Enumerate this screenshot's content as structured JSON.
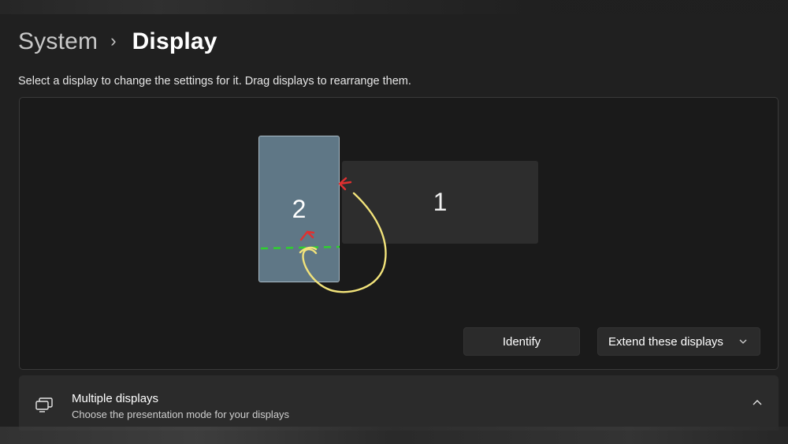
{
  "header": {
    "parent": "System",
    "separator": "›",
    "current": "Display"
  },
  "subtitle": "Select a display to change the settings for it. Drag displays to rearrange them.",
  "arrangement": {
    "displays": [
      {
        "number": "2",
        "selected": true
      },
      {
        "number": "1",
        "selected": false
      }
    ],
    "annotation_colors": {
      "arrow_red": "#e03030",
      "curve_yellow": "#f2e37a",
      "guide_green": "#2fd02f"
    }
  },
  "buttons": {
    "identify": "Identify",
    "extend": "Extend these displays",
    "extend_icon": "chevron-down-icon"
  },
  "multiple_displays": {
    "title": "Multiple displays",
    "description": "Choose the presentation mode for your displays",
    "icon": "multiple-displays-icon",
    "expander_icon": "chevron-up-icon"
  },
  "colors": {
    "background": "#202020",
    "panel": "#1a1a1a",
    "selected_display": "#5f7786",
    "display": "#2d2d2d",
    "button": "#2b2b2b"
  }
}
